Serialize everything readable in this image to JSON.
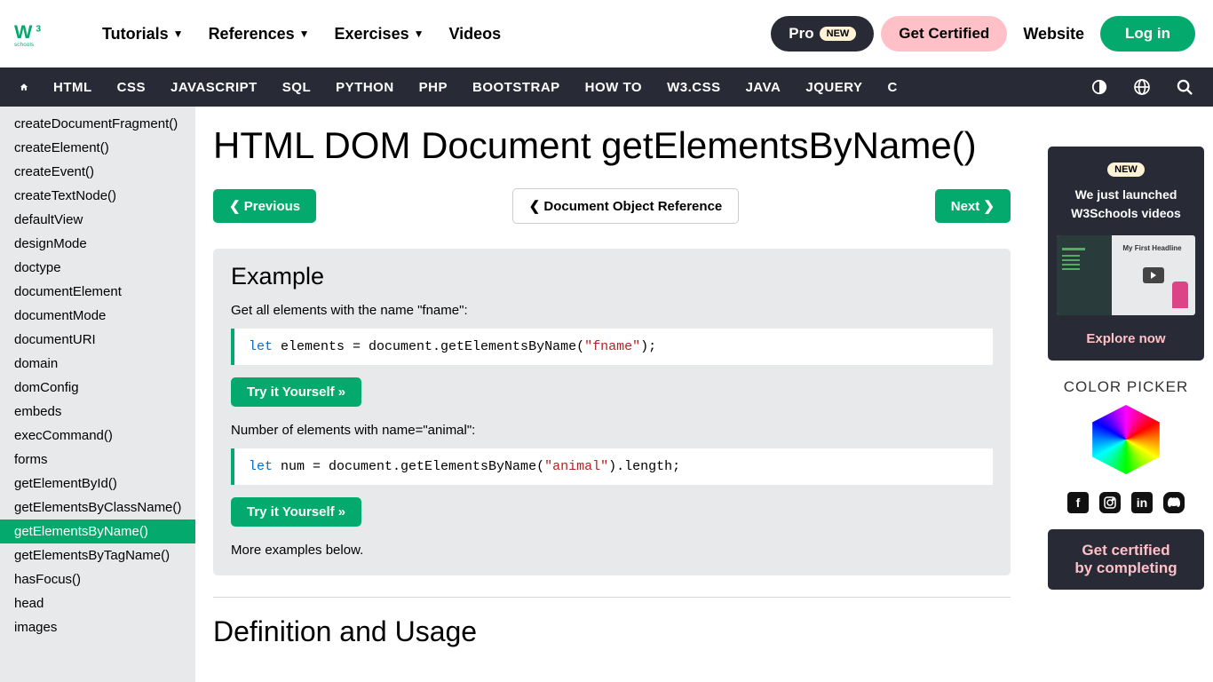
{
  "topnav": {
    "menu": [
      "Tutorials",
      "References",
      "Exercises",
      "Videos"
    ],
    "pro": "Pro",
    "pro_badge": "NEW",
    "certified": "Get Certified",
    "website": "Website",
    "login": "Log in"
  },
  "subnav": [
    "HTML",
    "CSS",
    "JAVASCRIPT",
    "SQL",
    "PYTHON",
    "PHP",
    "BOOTSTRAP",
    "HOW TO",
    "W3.CSS",
    "JAVA",
    "JQUERY",
    "C"
  ],
  "sidebar": [
    "createDocumentFragment()",
    "createElement()",
    "createEvent()",
    "createTextNode()",
    "defaultView",
    "designMode",
    "doctype",
    "documentElement",
    "documentMode",
    "documentURI",
    "domain",
    "domConfig",
    "embeds",
    "execCommand()",
    "forms",
    "getElementById()",
    "getElementsByClassName()",
    "getElementsByName()",
    "getElementsByTagName()",
    "hasFocus()",
    "head",
    "images"
  ],
  "sidebar_active": 17,
  "page_title": "HTML DOM Document getElementsByName()",
  "nav": {
    "prev": "Previous",
    "ref": "Document Object Reference",
    "next": "Next"
  },
  "example": {
    "heading": "Example",
    "desc1": "Get all elements with the name \"fname\":",
    "code1": {
      "kw": "let",
      "rest1": " elements = document.getElementsByName(",
      "str": "\"fname\"",
      "rest2": ");"
    },
    "try": "Try it Yourself »",
    "desc2": "Number of elements with name=\"animal\":",
    "code2": {
      "kw": "let",
      "rest1": " num = document.getElementsByName(",
      "str": "\"animal\"",
      "rest2": ").length;"
    },
    "more": "More examples below."
  },
  "section2": "Definition and Usage",
  "right": {
    "new": "NEW",
    "launched": "We just launched\nW3Schools videos",
    "explore": "Explore now",
    "cp": "COLOR PICKER",
    "cert": "Get certified\nby completing"
  }
}
